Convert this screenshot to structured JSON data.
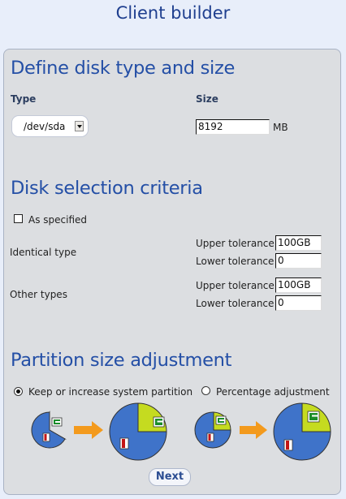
{
  "app": {
    "title": "Client builder"
  },
  "disk": {
    "heading": "Define disk type and size",
    "type_label": "Type",
    "size_label": "Size",
    "type_value": "/dev/sda",
    "size_value": "8192",
    "size_unit": "MB"
  },
  "criteria": {
    "heading": "Disk selection criteria",
    "as_specified_label": "As specified",
    "identical_type": {
      "label": "Identical type",
      "upper_label": "Upper tolerance",
      "upper_value": "100GB",
      "lower_label": "Lower tolerance",
      "lower_value": "0"
    },
    "other_types": {
      "label": "Other types",
      "upper_label": "Upper tolerance",
      "upper_value": "100GB",
      "lower_label": "Lower tolerance",
      "lower_value": "0"
    }
  },
  "partition": {
    "heading": "Partition size adjustment",
    "keep_label": "Keep or increase system partition",
    "percentage_label": "Percentage adjustment",
    "selected": "keep"
  },
  "colors": {
    "pie_blue": "#3f73c9",
    "pie_green": "#c5db20",
    "arrow": "#f39a1d",
    "heading": "#244fa6"
  },
  "next_label": "Next"
}
